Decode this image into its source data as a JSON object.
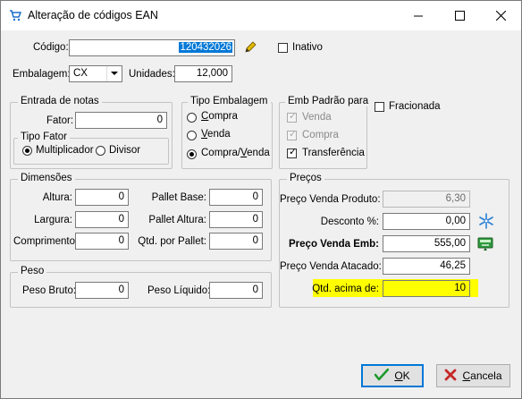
{
  "window": {
    "title": "Alteração de códigos EAN",
    "icons": {
      "app": "cart-icon",
      "minimize": "minimize-icon",
      "maximize": "maximize-icon",
      "close": "close-icon"
    }
  },
  "top": {
    "codigo_label": "Código:",
    "codigo_value": "120432026",
    "inativo_label": "Inativo",
    "inativo_checked": false,
    "embalagem_label": "Embalagem:",
    "embalagem_value": "CX",
    "unidades_label": "Unidades:",
    "unidades_value": "12,000"
  },
  "entrada_notas": {
    "title": "Entrada de notas",
    "fator_label": "Fator:",
    "fator_value": "0",
    "tipo_fator": {
      "title": "Tipo Fator",
      "opt_multiplicador": "Multiplicador",
      "opt_divisor": "Divisor",
      "selected": "Multiplicador"
    }
  },
  "tipo_embalagem": {
    "title": "Tipo Embalagem",
    "opt_compra": "Compra",
    "opt_venda": "Venda",
    "opt_compra_venda": "Compra/Venda",
    "selected": "Compra/Venda"
  },
  "emb_padrao": {
    "title": "Emb Padrão para",
    "venda": "Venda",
    "compra": "Compra",
    "transferencia": "Transferência",
    "venda_checked": true,
    "compra_checked": true,
    "transferencia_checked": true
  },
  "fracionada": {
    "label": "Fracionada",
    "checked": false
  },
  "dimensoes": {
    "title": "Dimensões",
    "altura_label": "Altura:",
    "altura_value": "0",
    "largura_label": "Largura:",
    "largura_value": "0",
    "comprimento_label": "Comprimento:",
    "comprimento_value": "0",
    "pallet_base_label": "Pallet Base:",
    "pallet_base_value": "0",
    "pallet_altura_label": "Pallet Altura:",
    "pallet_altura_value": "0",
    "qtd_pallet_label": "Qtd. por Pallet:",
    "qtd_pallet_value": "0"
  },
  "peso": {
    "title": "Peso",
    "bruto_label": "Peso Bruto:",
    "bruto_value": "0",
    "liquido_label": "Peso Líquido:",
    "liquido_value": "0"
  },
  "precos": {
    "title": "Preços",
    "venda_produto_label": "Preço Venda Produto:",
    "venda_produto_value": "6,30",
    "desconto_label": "Desconto %:",
    "desconto_value": "0,00",
    "venda_emb_label": "Preço Venda Emb:",
    "venda_emb_value": "555,00",
    "venda_atacado_label": "Preço Venda Atacado:",
    "venda_atacado_value": "46,25",
    "qtd_acima_label": "Qtd. acima de:",
    "qtd_acima_value": "10",
    "highlight_color": "#ffff00"
  },
  "buttons": {
    "ok": "OK",
    "cancel": "Cancela"
  }
}
